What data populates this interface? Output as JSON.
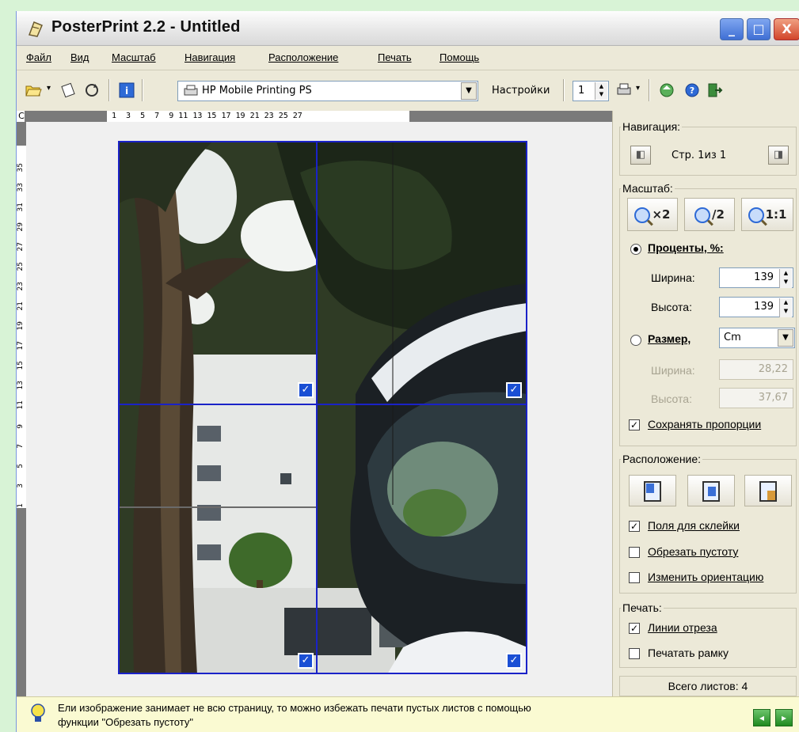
{
  "window": {
    "title": "PosterPrint 2.2 - Untitled",
    "min_glyph": "_",
    "max_glyph": "□",
    "close_glyph": "X"
  },
  "menu": [
    "Файл",
    "Вид",
    "Масштаб",
    "Навигация",
    "Расположение",
    "Печать",
    "Помощь"
  ],
  "toolbar": {
    "printer": "HP Mobile Printing PS",
    "settings_label": "Настройки",
    "copies": "1"
  },
  "rulers": {
    "corner": "C",
    "top": "1  3  5  7  9 11 13 15 17 19 21 23 25 27",
    "left": [
      "1",
      "3",
      "5",
      "7",
      "9",
      "11",
      "13",
      "15",
      "17",
      "19",
      "21",
      "23",
      "25",
      "27",
      "29",
      "31",
      "33",
      "35"
    ]
  },
  "tiles": {
    "check_glyph": "✓"
  },
  "panel": {
    "navigation": {
      "title": "Навигация:",
      "prev": "◧",
      "next": "◨",
      "page_text": "Стр. 1из 1"
    },
    "scale": {
      "title": "Масштаб:",
      "zoom_in": "×2",
      "zoom_out": "/2",
      "zoom_actual": "1:1",
      "percent_label": "Проценты, %:",
      "width_label": "Ширина:",
      "height_label": "Высота:",
      "width_value": "139",
      "height_value": "139",
      "size_label": "Размер,",
      "unit": "Cm",
      "size_width_label": "Ширина:",
      "size_height_label": "Высота:",
      "size_width_value": "28,22",
      "size_height_value": "37,67",
      "keep_ratio": "Сохранять пропорции",
      "keep_ratio_checked": true
    },
    "layout": {
      "title": "Расположение:",
      "glue_margins": "Поля для склейки",
      "glue_margins_checked": true,
      "crop_empty": "Обрезать пустоту",
      "crop_empty_checked": false,
      "change_orientation": "Изменить ориентацию",
      "change_orientation_checked": false
    },
    "print": {
      "title": "Печать:",
      "cut_lines": "Линии отреза",
      "cut_lines_checked": true,
      "print_frame": "Печатать рамку",
      "print_frame_checked": false
    },
    "totals": "Всего листов: 4"
  },
  "statusbar": {
    "hint_line1": "Ели изображение занимает не всю страницу, то можно избежать печати пустых листов с помощью",
    "hint_line2": "функции \"Обрезать пустоту\"",
    "back": "◂",
    "forward": "▸"
  }
}
